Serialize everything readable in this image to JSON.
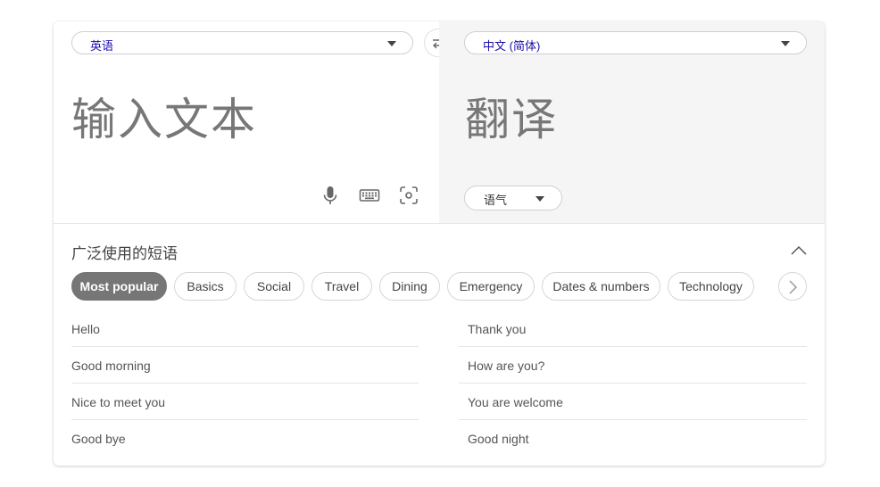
{
  "translator": {
    "source_language": "英语",
    "target_language": "中文 (简体)",
    "input_placeholder": "输入文本",
    "output_placeholder": "翻译",
    "tone_label": "语气"
  },
  "phrases": {
    "title": "广泛使用的短语",
    "categories": [
      {
        "label": "Most popular",
        "active": true
      },
      {
        "label": "Basics"
      },
      {
        "label": "Social"
      },
      {
        "label": "Travel"
      },
      {
        "label": "Dining"
      },
      {
        "label": "Emergency"
      },
      {
        "label": "Dates & numbers"
      },
      {
        "label": "Technology"
      }
    ],
    "left_column": [
      "Hello",
      "Good morning",
      "Nice to meet you",
      "Good bye"
    ],
    "right_column": [
      "Thank you",
      "How are you?",
      "You are welcome",
      "Good night"
    ]
  },
  "icons": {
    "swap": "swap-arrows-icon",
    "microphone": "microphone-icon",
    "keyboard": "keyboard-icon",
    "camera": "camera-scan-icon",
    "collapse": "chevron-up-icon",
    "next": "chevron-right-icon"
  },
  "colors": {
    "link_blue": "#1a0dab",
    "active_chip": "#767676",
    "output_bg": "#f5f5f5"
  }
}
